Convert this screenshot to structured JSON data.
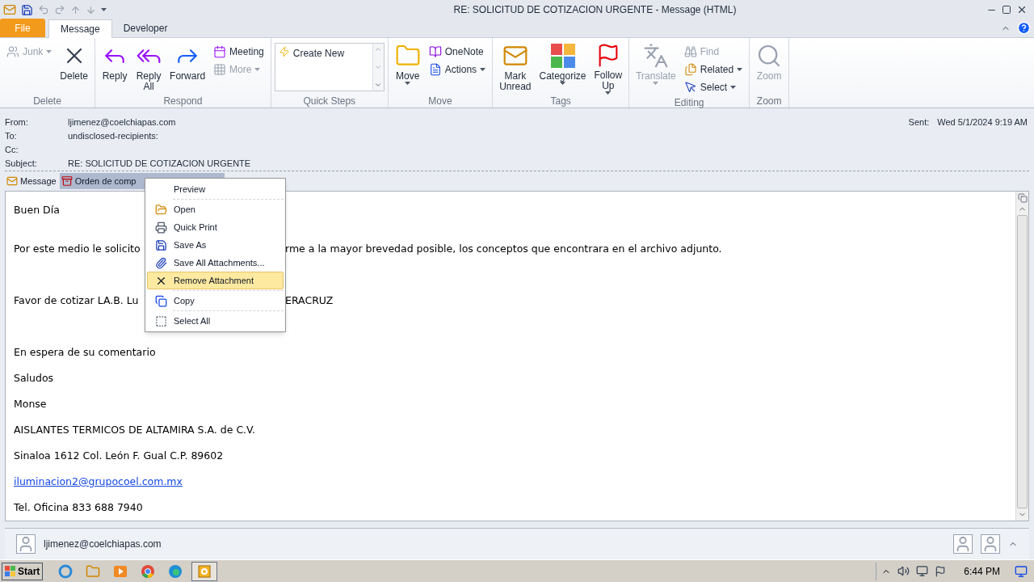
{
  "window": {
    "title": "RE: SOLICITUD DE COTIZACION URGENTE  -  Message (HTML)"
  },
  "ribbon_tabs": [
    {
      "label": "File",
      "kind": "file",
      "selected": false
    },
    {
      "label": "Message",
      "kind": "tab",
      "selected": true
    },
    {
      "label": "Developer",
      "kind": "tab",
      "selected": false
    }
  ],
  "ribbon_groups": [
    {
      "label": "Delete",
      "items": [
        {
          "label": "Junk",
          "kind": "small",
          "disabled": true,
          "dropdown": true
        },
        {
          "label": "Delete",
          "kind": "large",
          "disabled": false,
          "dropdown": false
        }
      ]
    },
    {
      "label": "Respond",
      "items": [
        {
          "label": "Reply",
          "kind": "large",
          "disabled": false,
          "dropdown": false
        },
        {
          "label": "Reply All",
          "kind": "large",
          "disabled": false,
          "dropdown": false
        },
        {
          "label": "Forward",
          "kind": "large",
          "disabled": false,
          "dropdown": false
        },
        {
          "label": "Meeting",
          "kind": "small",
          "disabled": false,
          "dropdown": false
        },
        {
          "label": "More",
          "kind": "small",
          "disabled": true,
          "dropdown": true
        }
      ]
    },
    {
      "label": "Quick Steps",
      "items": [
        {
          "label": "Create New",
          "kind": "gallery"
        }
      ]
    },
    {
      "label": "Move",
      "items": [
        {
          "label": "Move",
          "kind": "large",
          "disabled": false,
          "dropdown": true
        },
        {
          "label": "OneNote",
          "kind": "small",
          "disabled": false,
          "dropdown": false
        },
        {
          "label": "Actions",
          "kind": "small",
          "disabled": false,
          "dropdown": true
        }
      ]
    },
    {
      "label": "Tags",
      "items": [
        {
          "label": "Mark Unread",
          "kind": "large",
          "disabled": false,
          "dropdown": false
        },
        {
          "label": "Categorize",
          "kind": "large",
          "disabled": false,
          "dropdown": true
        },
        {
          "label": "Follow Up",
          "kind": "large",
          "disabled": false,
          "dropdown": true
        }
      ]
    },
    {
      "label": "Editing",
      "items": [
        {
          "label": "Translate",
          "kind": "large",
          "disabled": true,
          "dropdown": true
        },
        {
          "label": "Find",
          "kind": "small",
          "disabled": true,
          "dropdown": false
        },
        {
          "label": "Related",
          "kind": "small",
          "disabled": false,
          "dropdown": true
        },
        {
          "label": "Select",
          "kind": "small",
          "disabled": false,
          "dropdown": true
        }
      ]
    },
    {
      "label": "Zoom",
      "items": [
        {
          "label": "Zoom",
          "kind": "large",
          "disabled": true,
          "dropdown": false
        }
      ]
    }
  ],
  "header": {
    "fields": [
      {
        "label": "From:",
        "value": "ljimenez@coelchiapas.com"
      },
      {
        "label": "To:",
        "value": "undisclosed-recipients:"
      },
      {
        "label": "Cc:"
      },
      {
        "label": "Subject:",
        "value": "RE: SOLICITUD DE COTIZACION URGENTE"
      }
    ],
    "sent": {
      "label": "Sent:",
      "value": "Wed 5/1/2024 9:19 AM"
    }
  },
  "attachments": [
    {
      "label": "Message",
      "kind": "message",
      "selected": false
    },
    {
      "label": "Orden de comp",
      "kind": "archive",
      "selected": true
    }
  ],
  "body": [
    {
      "kind": "text",
      "text": "Buen Día"
    },
    {
      "kind": "split",
      "text": "Por este medio le solicito",
      "text_after": "rme a la mayor brevedad posible, los conceptos que encontrara en el archivo adjunto."
    },
    {
      "kind": "split",
      "text": "Favor de cotizar LA.B. Lu",
      "text_after": "ERACRUZ"
    },
    {
      "kind": "text",
      "text": "En espera de su comentario"
    },
    {
      "kind": "text",
      "text": "Saludos"
    },
    {
      "kind": "text",
      "text": "Monse"
    },
    {
      "kind": "text",
      "text": "AISLANTES TERMICOS DE ALTAMIRA S.A. de C.V."
    },
    {
      "kind": "text",
      "text": "Sinaloa 1612 Col. León F. Gual C.P. 89602"
    },
    {
      "kind": "link",
      "text": "iluminacion2@grupocoel.com.mx"
    },
    {
      "kind": "text",
      "text": "Tel. Oficina 833 688 7940"
    }
  ],
  "context_menu": [
    {
      "label": "Preview",
      "selected": false,
      "separator_after": true
    },
    {
      "label": "Open",
      "selected": false,
      "separator_after": false
    },
    {
      "label": "Quick Print",
      "selected": false,
      "separator_after": false
    },
    {
      "label": "Save As",
      "selected": false,
      "separator_after": false
    },
    {
      "label": "Save All Attachments...",
      "selected": false,
      "separator_after": false
    },
    {
      "label": "Remove Attachment",
      "selected": true,
      "separator_after": true
    },
    {
      "label": "Copy",
      "selected": false,
      "separator_after": true
    },
    {
      "label": "Select All",
      "selected": false,
      "separator_after": false
    }
  ],
  "people_pane": {
    "name": "ljimenez@coelchiapas.com"
  },
  "taskbar": {
    "start": "Start",
    "clock": "6:44 PM"
  }
}
